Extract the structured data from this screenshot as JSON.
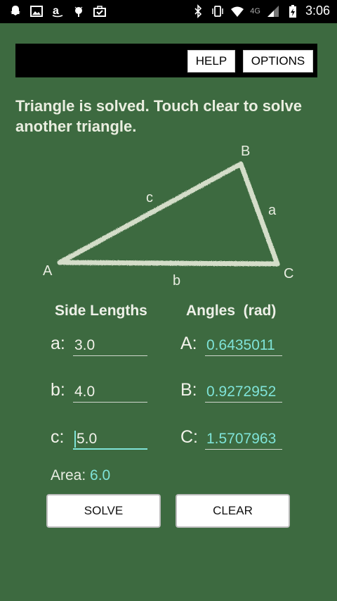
{
  "status_bar": {
    "time": "3:06",
    "network": "4G",
    "left_icons": [
      "snapchat-icon",
      "image-icon",
      "amazon-icon",
      "android-debug-icon",
      "briefcase-check-icon"
    ],
    "right_icons": [
      "bluetooth-icon",
      "vibrate-icon",
      "wifi-icon",
      "signal-icon",
      "battery-charging-icon"
    ]
  },
  "toolbar": {
    "help_label": "HELP",
    "options_label": "OPTIONS"
  },
  "message": "Triangle is solved. Touch clear to solve another triangle.",
  "diagram": {
    "vertices": {
      "A": "A",
      "B": "B",
      "C": "C"
    },
    "sides": {
      "a": "a",
      "b": "b",
      "c": "c"
    }
  },
  "sides": {
    "header": "Side Lengths",
    "rows": [
      {
        "label": "a:",
        "value": "3.0"
      },
      {
        "label": "b:",
        "value": "4.0"
      },
      {
        "label": "c:",
        "value": "5.0"
      }
    ]
  },
  "angles": {
    "header": "Angles  (rad)",
    "rows": [
      {
        "label": "A:",
        "value": "0.6435011"
      },
      {
        "label": "B:",
        "value": "0.9272952"
      },
      {
        "label": "C:",
        "value": "1.5707963"
      }
    ]
  },
  "area": {
    "label": "Area:",
    "value": "6.0"
  },
  "buttons": {
    "solve": "SOLVE",
    "clear": "CLEAR"
  },
  "colors": {
    "background": "#3d6a40",
    "accent": "#7fe3d8",
    "chalk": "#e4ead8"
  }
}
